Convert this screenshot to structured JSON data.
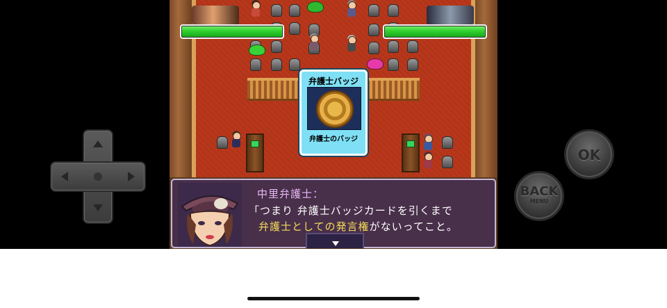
{
  "hud": {
    "player_hp_fraction": 1.0,
    "opponent_hp_fraction": 1.0,
    "hp_color": "#2fd12f"
  },
  "item_card": {
    "title": "弁護士バッジ",
    "caption": "弁護士のバッジ",
    "background_color": "#7fe0f5"
  },
  "dialogue": {
    "speaker": "中里弁護士：",
    "line1": "「つまり 弁護士バッジカードを引くまで",
    "line2_highlight": "弁護士としての発言権",
    "line2_rest": "がないってこと。",
    "highlight_color": "#f5dd5a",
    "next_icon": "triangle-down-icon"
  },
  "controls": {
    "dpad_icon": "dpad-icon",
    "ok_label": "OK",
    "back_label": "BACK",
    "back_sublabel": "MENU"
  }
}
